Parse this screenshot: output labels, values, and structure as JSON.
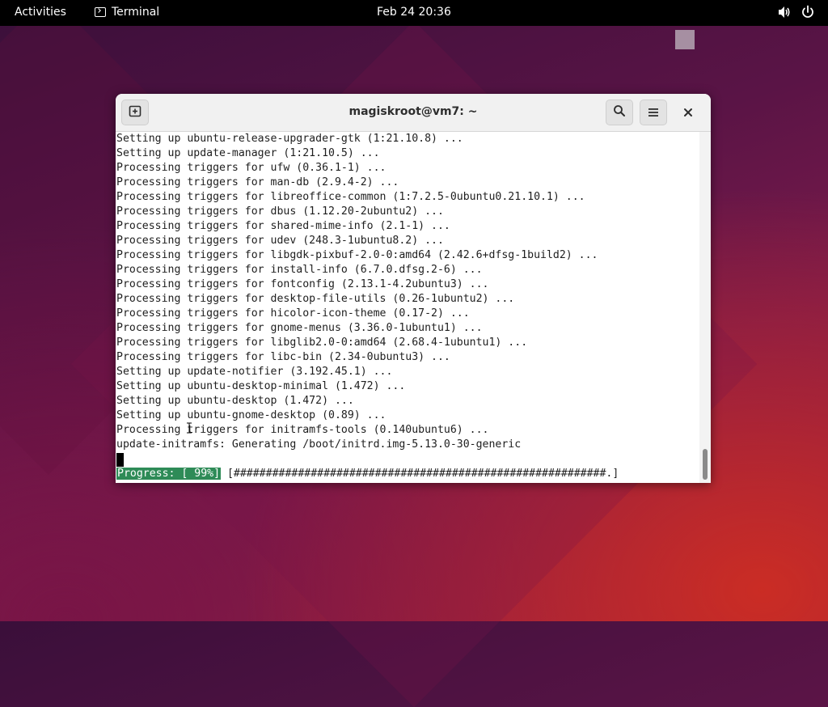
{
  "topbar": {
    "activities_label": "Activities",
    "app_name": "Terminal",
    "clock": "Feb 24  20:36"
  },
  "window": {
    "title": "magiskroot@vm7: ~"
  },
  "terminal": {
    "lines": [
      "Setting up ubuntu-release-upgrader-gtk (1:21.10.8) ...",
      "Setting up update-manager (1:21.10.5) ...",
      "Processing triggers for ufw (0.36.1-1) ...",
      "Processing triggers for man-db (2.9.4-2) ...",
      "Processing triggers for libreoffice-common (1:7.2.5-0ubuntu0.21.10.1) ...",
      "Processing triggers for dbus (1.12.20-2ubuntu2) ...",
      "Processing triggers for shared-mime-info (2.1-1) ...",
      "Processing triggers for udev (248.3-1ubuntu8.2) ...",
      "Processing triggers for libgdk-pixbuf-2.0-0:amd64 (2.42.6+dfsg-1build2) ...",
      "Processing triggers for install-info (6.7.0.dfsg.2-6) ...",
      "Processing triggers for fontconfig (2.13.1-4.2ubuntu3) ...",
      "Processing triggers for desktop-file-utils (0.26-1ubuntu2) ...",
      "Processing triggers for hicolor-icon-theme (0.17-2) ...",
      "Processing triggers for gnome-menus (3.36.0-1ubuntu1) ...",
      "Processing triggers for libglib2.0-0:amd64 (2.68.4-1ubuntu1) ...",
      "Processing triggers for libc-bin (2.34-0ubuntu3) ...",
      "Setting up update-notifier (3.192.45.1) ...",
      "Setting up ubuntu-desktop-minimal (1.472) ...",
      "Setting up ubuntu-desktop (1.472) ...",
      "Setting up ubuntu-gnome-desktop (0.89) ...",
      "Processing triggers for initramfs-tools (0.140ubuntu6) ...",
      "update-initramfs: Generating /boot/initrd.img-5.13.0-30-generic"
    ],
    "progress_label": "Progress: [ 99%]",
    "progress_bar": " [##########################################################.]",
    "progress_percent": 99
  },
  "icons": {
    "new_tab": "new-tab-icon",
    "search": "search-icon",
    "menu": "hamburger-menu-icon",
    "close": "close-icon",
    "volume": "volume-icon",
    "power": "power-icon",
    "terminal": "terminal-icon"
  },
  "colors": {
    "progress_bg": "#2e8b57",
    "topbar_bg": "#000000"
  }
}
